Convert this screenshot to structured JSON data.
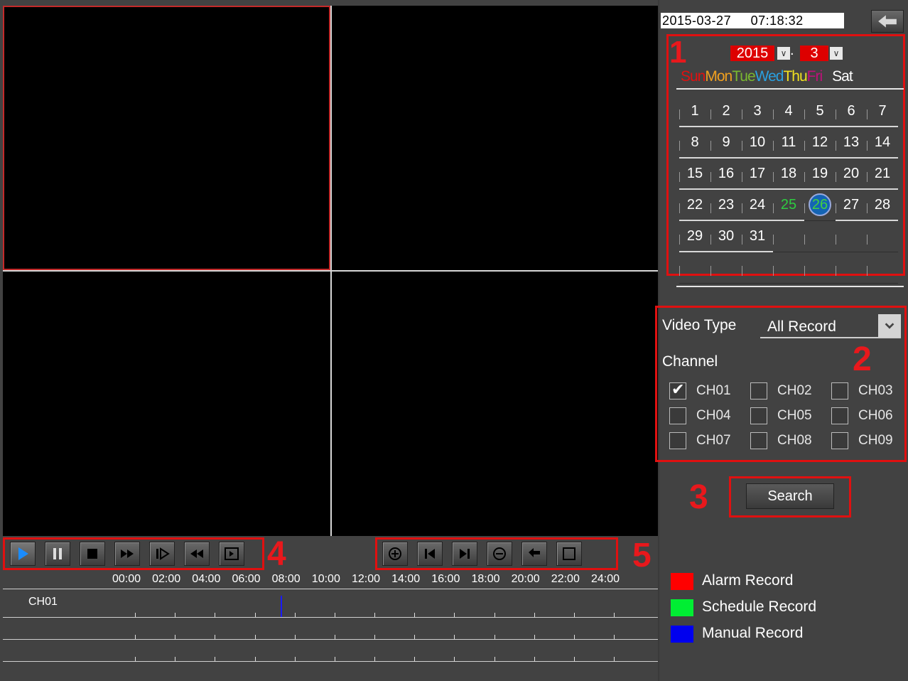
{
  "datetime": "2015-03-27     07:18:32",
  "calendar": {
    "year": "2015",
    "month": "3",
    "weekdays": [
      {
        "label": "Sun",
        "color": "#e01010"
      },
      {
        "label": "Mon",
        "color": "#f0a020"
      },
      {
        "label": "Tue",
        "color": "#7ab830"
      },
      {
        "label": "Wed",
        "color": "#2aa0e0"
      },
      {
        "label": "Thu",
        "color": "#f0e020"
      },
      {
        "label": "Fri",
        "color": "#c0107a"
      },
      {
        "label": "Sat",
        "color": "#ffffff"
      }
    ],
    "days": [
      "1",
      "2",
      "3",
      "4",
      "5",
      "6",
      "7",
      "8",
      "9",
      "10",
      "11",
      "12",
      "13",
      "14",
      "15",
      "16",
      "17",
      "18",
      "19",
      "20",
      "21",
      "22",
      "23",
      "24",
      "25",
      "26",
      "27",
      "28",
      "29",
      "30",
      "31"
    ],
    "days_with_records": [
      "25",
      "26"
    ],
    "selected_day": "26",
    "region_number": "1"
  },
  "filters": {
    "video_type_label": "Video Type",
    "video_type_value": "All Record",
    "channel_label": "Channel",
    "channels": [
      {
        "label": "CH01",
        "checked": true
      },
      {
        "label": "CH02",
        "checked": false
      },
      {
        "label": "CH03",
        "checked": false
      },
      {
        "label": "CH04",
        "checked": false
      },
      {
        "label": "CH05",
        "checked": false
      },
      {
        "label": "CH06",
        "checked": false
      },
      {
        "label": "CH07",
        "checked": false
      },
      {
        "label": "CH08",
        "checked": false
      },
      {
        "label": "CH09",
        "checked": false
      }
    ],
    "region_number": "2"
  },
  "search": {
    "label": "Search",
    "region_number": "3"
  },
  "playback_controls": {
    "region_number": "4",
    "buttons": [
      "play-icon",
      "pause-icon",
      "stop-icon",
      "fast-forward-icon",
      "slow-play-icon",
      "rewind-icon",
      "single-frame-icon"
    ]
  },
  "timeline_controls": {
    "region_number": "5",
    "buttons": [
      "zoom-in-icon",
      "previous-icon",
      "next-icon",
      "zoom-out-icon",
      "back-icon",
      "fullscreen-icon"
    ]
  },
  "timeline": {
    "hours": [
      "00:00",
      "02:00",
      "04:00",
      "06:00",
      "08:00",
      "10:00",
      "12:00",
      "14:00",
      "16:00",
      "18:00",
      "20:00",
      "22:00",
      "24:00"
    ],
    "rows": [
      {
        "label": "CH01"
      },
      {
        "label": ""
      },
      {
        "label": ""
      }
    ],
    "manual_record_marker_time": "07:18"
  },
  "legend": [
    {
      "label": "Alarm Record",
      "color": "#ff0000"
    },
    {
      "label": "Schedule Record",
      "color": "#00ee33"
    },
    {
      "label": "Manual Record",
      "color": "#0000ee"
    }
  ]
}
